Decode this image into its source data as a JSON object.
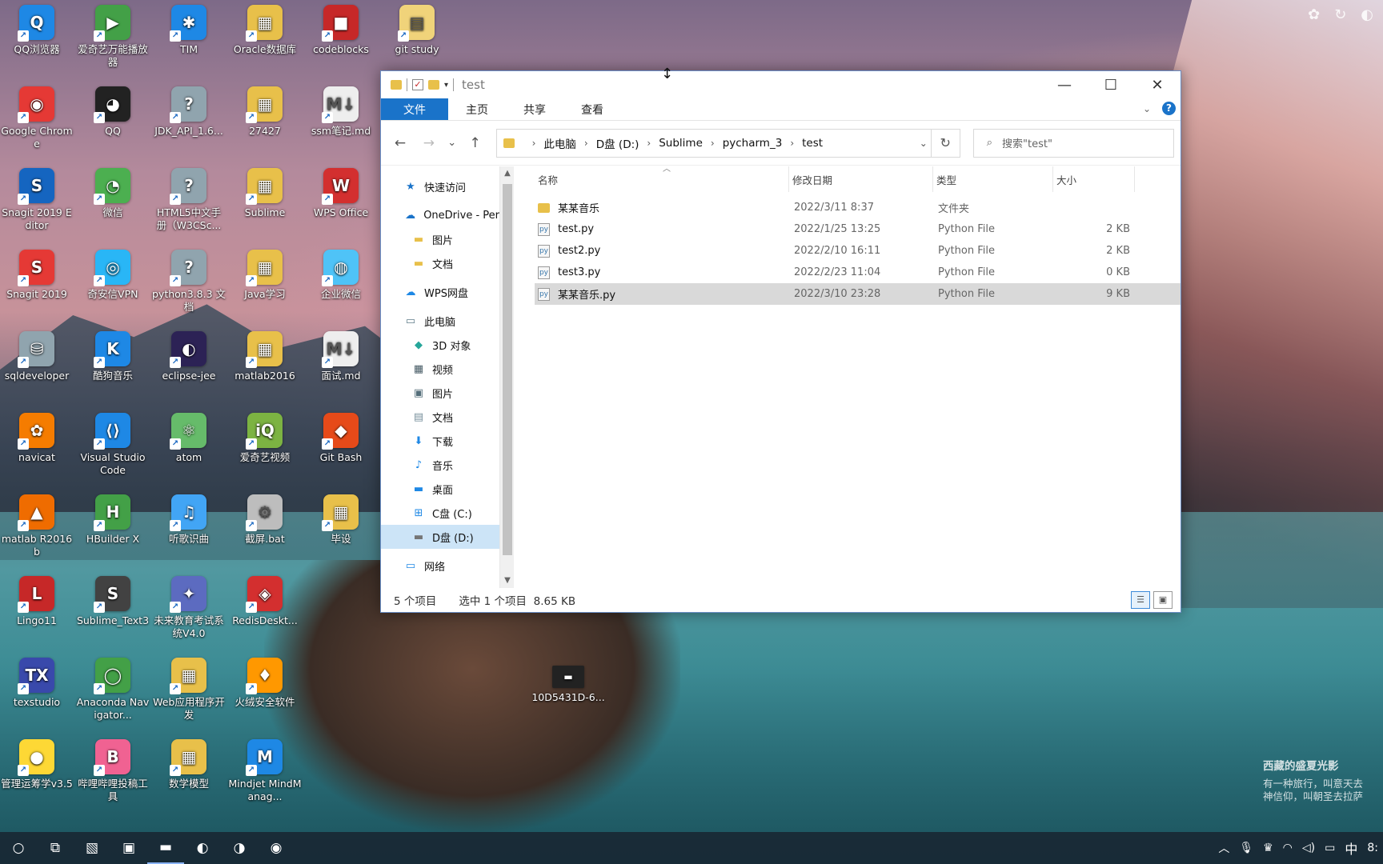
{
  "desktop": {
    "icons": [
      {
        "label": "QQ浏览器",
        "color": "#1e88e5",
        "glyph": "Q"
      },
      {
        "label": "爱奇艺万能播放器",
        "color": "#43a047",
        "glyph": "▶"
      },
      {
        "label": "TIM",
        "color": "#1e88e5",
        "glyph": "✱"
      },
      {
        "label": "Oracle数据库",
        "color": "#e8c04a",
        "glyph": "▦"
      },
      {
        "label": "codeblocks",
        "color": "#c62828",
        "glyph": "■"
      },
      {
        "label": "git study",
        "color": "#f0d37a",
        "glyph": "▤"
      },
      {
        "label": "Google Chrome",
        "color": "#e53935",
        "glyph": "◉"
      },
      {
        "label": "QQ",
        "color": "#222222",
        "glyph": "◕"
      },
      {
        "label": "JDK_API_1.6...",
        "color": "#90a4ae",
        "glyph": "?"
      },
      {
        "label": "27427",
        "color": "#e8c04a",
        "glyph": "▦"
      },
      {
        "label": "ssm笔记.md",
        "color": "#eeeeee",
        "glyph": "M↓"
      },
      {
        "label": "Snagit 2019 Editor",
        "color": "#1565c0",
        "glyph": "S"
      },
      {
        "label": "微信",
        "color": "#4caf50",
        "glyph": "◔"
      },
      {
        "label": "HTML5中文手册（W3CSc...",
        "color": "#90a4ae",
        "glyph": "?"
      },
      {
        "label": "Sublime",
        "color": "#e8c04a",
        "glyph": "▦"
      },
      {
        "label": "WPS Office",
        "color": "#d32f2f",
        "glyph": "W"
      },
      {
        "label": "Snagit 2019",
        "color": "#e53935",
        "glyph": "S"
      },
      {
        "label": "奇安信VPN",
        "color": "#29b6f6",
        "glyph": "◎"
      },
      {
        "label": "python3.8.3 文档",
        "color": "#90a4ae",
        "glyph": "?"
      },
      {
        "label": "Java学习",
        "color": "#e8c04a",
        "glyph": "▦"
      },
      {
        "label": "企业微信",
        "color": "#4fc3f7",
        "glyph": "◍"
      },
      {
        "label": "sqldeveloper",
        "color": "#90a4ae",
        "glyph": "⛁"
      },
      {
        "label": "酷狗音乐",
        "color": "#1e88e5",
        "glyph": "K"
      },
      {
        "label": "eclipse-jee",
        "color": "#2c2255",
        "glyph": "◐"
      },
      {
        "label": "matlab2016",
        "color": "#e8c04a",
        "glyph": "▦"
      },
      {
        "label": "面试.md",
        "color": "#eeeeee",
        "glyph": "M↓"
      },
      {
        "label": "navicat",
        "color": "#f57c00",
        "glyph": "✿"
      },
      {
        "label": "Visual Studio Code",
        "color": "#1e88e5",
        "glyph": "⟨⟩"
      },
      {
        "label": "atom",
        "color": "#66bb6a",
        "glyph": "⚛"
      },
      {
        "label": "爱奇艺视频",
        "color": "#7cb342",
        "glyph": "iQ"
      },
      {
        "label": "Git Bash",
        "color": "#e64a19",
        "glyph": "◆"
      },
      {
        "label": "matlab R2016b",
        "color": "#ef6c00",
        "glyph": "▲"
      },
      {
        "label": "HBuilder X",
        "color": "#43a047",
        "glyph": "H"
      },
      {
        "label": "听歌识曲",
        "color": "#42a5f5",
        "glyph": "♫"
      },
      {
        "label": "截屏.bat",
        "color": "#bdbdbd",
        "glyph": "⚙"
      },
      {
        "label": "毕设",
        "color": "#e8c04a",
        "glyph": "▦"
      },
      {
        "label": "Lingo11",
        "color": "#c62828",
        "glyph": "L"
      },
      {
        "label": "Sublime_Text3",
        "color": "#424242",
        "glyph": "S"
      },
      {
        "label": "未来教育考试系统V4.0",
        "color": "#5c6bc0",
        "glyph": "✦"
      },
      {
        "label": "RedisDeskt...",
        "color": "#d32f2f",
        "glyph": "◈"
      },
      {
        "label": "texstudio",
        "color": "#3949ab",
        "glyph": "TX"
      },
      {
        "label": "Anaconda Navigator...",
        "color": "#43a047",
        "glyph": "◯"
      },
      {
        "label": "Web应用程序开发",
        "color": "#e8c04a",
        "glyph": "▦"
      },
      {
        "label": "火绒安全软件",
        "color": "#ff9800",
        "glyph": "♦"
      },
      {
        "label": "管理运筹学v3.5",
        "color": "#fdd835",
        "glyph": "●"
      },
      {
        "label": "哔哩哔哩投稿工具",
        "color": "#f06292",
        "glyph": "B"
      },
      {
        "label": "数学模型",
        "color": "#e8c04a",
        "glyph": "▦"
      },
      {
        "label": "Mindjet MindManag...",
        "color": "#1e88e5",
        "glyph": "M"
      }
    ],
    "loose_icon": {
      "label": "10D5431D-6..."
    },
    "watermark": {
      "title": "西藏的盛夏光影",
      "line1": "有一种旅行，叫意天去",
      "line2": "神信仰，叫朝圣去拉萨"
    }
  },
  "window": {
    "title": "test",
    "controls": {
      "minimize": "—",
      "maximize": "☐",
      "close": "✕"
    },
    "ribbon_tabs": [
      "文件",
      "主页",
      "共享",
      "查看"
    ],
    "help": "?",
    "nav": {
      "back": "←",
      "forward": "→",
      "recent": "⌄",
      "up": "↑"
    },
    "breadcrumbs": [
      "此电脑",
      "D盘 (D:)",
      "Sublime",
      "pycharm_3",
      "test"
    ],
    "refresh": "↻",
    "search_placeholder": "搜索\"test\"",
    "search_icon": "⌕",
    "nav_pane": [
      {
        "label": "快速访问",
        "icon": "★",
        "color": "#1a73c9",
        "indent": 1
      },
      {
        "label": "OneDrive - Per",
        "icon": "☁",
        "color": "#1a73c9",
        "indent": 1
      },
      {
        "label": "图片",
        "icon": "▬",
        "color": "#e8c04a",
        "indent": 2
      },
      {
        "label": "文档",
        "icon": "▬",
        "color": "#e8c04a",
        "indent": 2
      },
      {
        "label": "WPS网盘",
        "icon": "☁",
        "color": "#1e88e5",
        "indent": 1
      },
      {
        "label": "此电脑",
        "icon": "▭",
        "color": "#607d8b",
        "indent": 1
      },
      {
        "label": "3D 对象",
        "icon": "◆",
        "color": "#26a69a",
        "indent": 2
      },
      {
        "label": "视频",
        "icon": "▦",
        "color": "#455a64",
        "indent": 2
      },
      {
        "label": "图片",
        "icon": "▣",
        "color": "#546e7a",
        "indent": 2
      },
      {
        "label": "文档",
        "icon": "▤",
        "color": "#78909c",
        "indent": 2
      },
      {
        "label": "下载",
        "icon": "⬇",
        "color": "#1e88e5",
        "indent": 2
      },
      {
        "label": "音乐",
        "icon": "♪",
        "color": "#1e88e5",
        "indent": 2
      },
      {
        "label": "桌面",
        "icon": "▬",
        "color": "#1e88e5",
        "indent": 2
      },
      {
        "label": "C盘 (C:)",
        "icon": "⊞",
        "color": "#1e88e5",
        "indent": 2
      },
      {
        "label": "D盘 (D:)",
        "icon": "▬",
        "color": "#757575",
        "indent": 2,
        "selected": true
      },
      {
        "label": "网络",
        "icon": "▭",
        "color": "#1e88e5",
        "indent": 1
      }
    ],
    "columns": [
      "名称",
      "修改日期",
      "类型",
      "大小"
    ],
    "files": [
      {
        "name": "某某音乐",
        "date": "2022/3/11 8:37",
        "type": "文件夹",
        "size": "",
        "kind": "folder",
        "selected": false
      },
      {
        "name": "test.py",
        "date": "2022/1/25 13:25",
        "type": "Python File",
        "size": "2 KB",
        "kind": "py",
        "selected": false
      },
      {
        "name": "test2.py",
        "date": "2022/2/10 16:11",
        "type": "Python File",
        "size": "2 KB",
        "kind": "py",
        "selected": false
      },
      {
        "name": "test3.py",
        "date": "2022/2/23 11:04",
        "type": "Python File",
        "size": "0 KB",
        "kind": "py",
        "selected": false
      },
      {
        "name": "某某音乐.py",
        "date": "2022/3/10 23:28",
        "type": "Python File",
        "size": "9 KB",
        "kind": "py",
        "selected": true
      }
    ],
    "status": {
      "count": "5 个项目",
      "selection": "选中 1 个项目  8.65 KB"
    }
  },
  "taskbar": {
    "items": [
      {
        "name": "cortana-icon",
        "glyph": "○"
      },
      {
        "name": "task-view-icon",
        "glyph": "⧉"
      },
      {
        "name": "image-viewer-icon",
        "glyph": "▧"
      },
      {
        "name": "terminal-icon",
        "glyph": "▣"
      },
      {
        "name": "file-explorer-icon",
        "glyph": "▬"
      },
      {
        "name": "edge-icon",
        "glyph": "◐"
      },
      {
        "name": "qq-browser-icon",
        "glyph": "◑"
      },
      {
        "name": "chrome-icon",
        "glyph": "◉"
      }
    ],
    "tray": {
      "chevron": "︿",
      "mic": "🎙",
      "app": "♛",
      "wifi": "◠",
      "volume": "◁)",
      "battery": "▭",
      "ime": "中",
      "clock": "8:"
    }
  }
}
